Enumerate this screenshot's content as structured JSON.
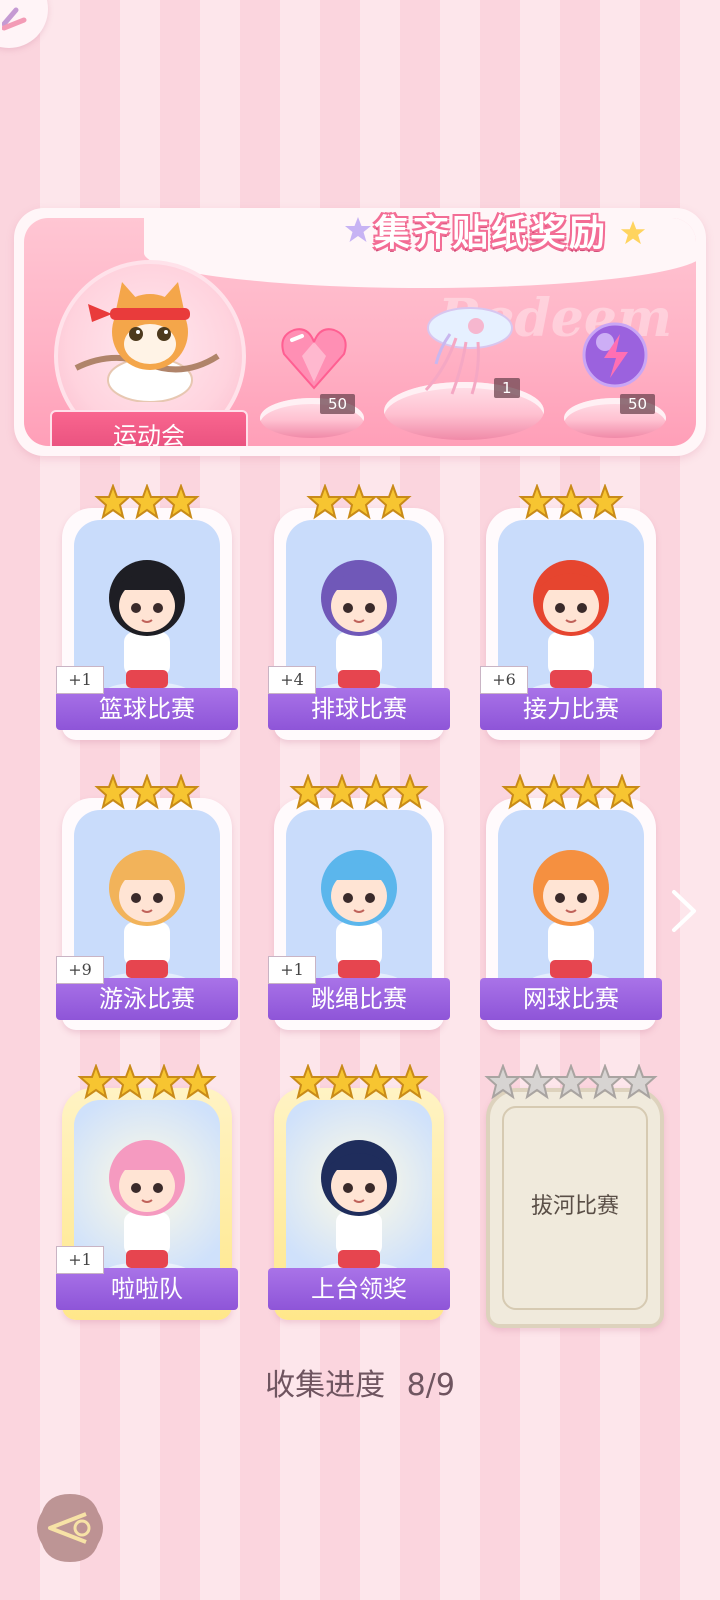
{
  "banner": {
    "title": "集齐贴纸奖励",
    "watermark": "Redeem",
    "event_name": "运动会",
    "rewards": [
      {
        "icon": "pink-heart-gem-icon",
        "count": "50"
      },
      {
        "icon": "jellyfish-ornament-icon",
        "count": "1"
      },
      {
        "icon": "purple-lightning-orb-icon",
        "count": "50"
      }
    ]
  },
  "cards": [
    {
      "label": "篮球比赛",
      "stars": 3,
      "plus": "+1",
      "state": "collected",
      "icon": "basketball-girl-icon"
    },
    {
      "label": "排球比赛",
      "stars": 3,
      "plus": "+4",
      "state": "collected",
      "icon": "volleyball-girl-icon"
    },
    {
      "label": "接力比赛",
      "stars": 3,
      "plus": "+6",
      "state": "collected",
      "icon": "relay-runner-icon"
    },
    {
      "label": "游泳比赛",
      "stars": 3,
      "plus": "+9",
      "state": "collected",
      "icon": "swimming-dog-icon"
    },
    {
      "label": "跳绳比赛",
      "stars": 4,
      "plus": "+1",
      "state": "collected",
      "icon": "jump-rope-girl-icon"
    },
    {
      "label": "网球比赛",
      "stars": 4,
      "plus": "",
      "state": "collected",
      "icon": "tennis-girl-icon"
    },
    {
      "label": "啦啦队",
      "stars": 4,
      "plus": "+1",
      "state": "gold",
      "icon": "cheerleader-icon"
    },
    {
      "label": "上台领奖",
      "stars": 4,
      "plus": "",
      "state": "gold",
      "icon": "trophy-winner-icon"
    },
    {
      "label": "拔河比赛",
      "stars": 5,
      "plus": "",
      "state": "locked",
      "icon": ""
    }
  ],
  "progress": {
    "label": "收集进度",
    "value": "8/9"
  },
  "colors": {
    "accent_purple": "#9b62de",
    "title_pink": "#f36d95",
    "star_gold": "#f7c531"
  }
}
